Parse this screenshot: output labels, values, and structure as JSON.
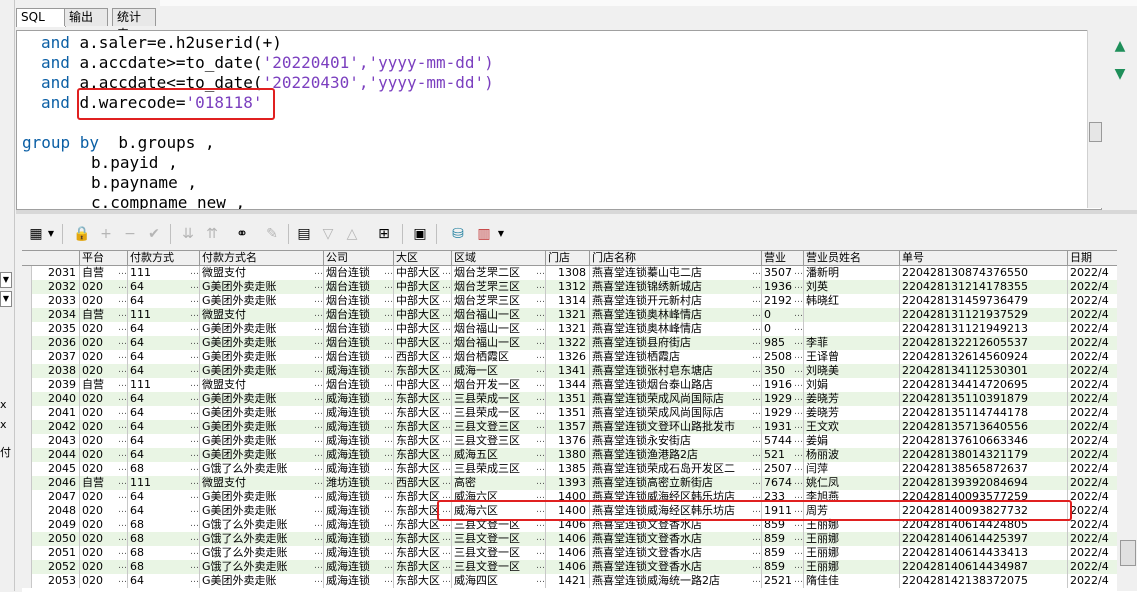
{
  "tabs": [
    "SQL",
    "输出",
    "统计表"
  ],
  "editor": {
    "lines": [
      {
        "kw": "and",
        "code": " a.saler=e.h2userid(+)",
        "str": ""
      },
      {
        "kw": "and",
        "code": " a.accdate>=to_date(",
        "str": "'20220401','yyyy-mm-dd')"
      },
      {
        "kw": "and",
        "code": " a.accdate<=to_date(",
        "str": "'20220430','yyyy-mm-dd')"
      },
      {
        "kw": "and",
        "code": " d.warecode=",
        "str": "'018118'"
      },
      {
        "kw": "",
        "code": "",
        "str": ""
      },
      {
        "kw": "group by",
        "code": "  b.groups ,",
        "str": ""
      },
      {
        "kw": "",
        "code": "b.payid ,",
        "str": ""
      },
      {
        "kw": "",
        "code": "b.payname ,",
        "str": ""
      },
      {
        "kw": "",
        "code": "c.compname_new ,",
        "str": ""
      }
    ]
  },
  "side_left": [
    "x",
    "x",
    "付"
  ],
  "toolbar_icons": [
    "grid-icon",
    "lock-icon",
    "add-icon",
    "delete-icon",
    "check-icon",
    "post-down-icon",
    "post-up-icon",
    "binoculars-icon",
    "eraser-icon",
    "export-icon",
    "sort-down-icon",
    "sort-up-icon",
    "tree-icon",
    "save-icon",
    "database-icon",
    "chart-icon"
  ],
  "columns": [
    "",
    "平台",
    "付款方式",
    "付款方式名",
    "公司",
    "大区",
    "区域",
    "门店",
    "门店名称",
    "营业",
    "营业员姓名",
    "单号",
    "日期"
  ],
  "rows": [
    [
      "2031",
      "自营",
      "111",
      "微盟支付",
      "烟台连锁",
      "中部大区",
      "烟台芝罘二区",
      "1308",
      "燕喜堂连锁蓁山屯二店",
      "3507",
      "潘新明",
      "220428130874376550",
      "2022/4"
    ],
    [
      "2032",
      "020",
      "64",
      "G美团外卖走账",
      "烟台连锁",
      "中部大区",
      "烟台芝罘三区",
      "1312",
      "燕喜堂连锁锦绣新城店",
      "1936",
      "刘英",
      "220428131214178355",
      "2022/4"
    ],
    [
      "2033",
      "020",
      "64",
      "G美团外卖走账",
      "烟台连锁",
      "中部大区",
      "烟台芝罘三区",
      "1314",
      "燕喜堂连锁开元新村店",
      "2192",
      "韩晓红",
      "220428131459736479",
      "2022/4"
    ],
    [
      "2034",
      "自营",
      "111",
      "微盟支付",
      "烟台连锁",
      "中部大区",
      "烟台福山一区",
      "1321",
      "燕喜堂连锁奥林峰情店",
      "0",
      "",
      "220428131121937529",
      "2022/4"
    ],
    [
      "2035",
      "020",
      "64",
      "G美团外卖走账",
      "烟台连锁",
      "中部大区",
      "烟台福山一区",
      "1321",
      "燕喜堂连锁奥林峰情店",
      "0",
      "",
      "220428131121949213",
      "2022/4"
    ],
    [
      "2036",
      "020",
      "64",
      "G美团外卖走账",
      "烟台连锁",
      "中部大区",
      "烟台福山一区",
      "1322",
      "燕喜堂连锁县府街店",
      "985",
      "李菲",
      "220428132212605537",
      "2022/4"
    ],
    [
      "2037",
      "020",
      "64",
      "G美团外卖走账",
      "烟台连锁",
      "西部大区",
      "烟台栖霞区",
      "1326",
      "燕喜堂连锁栖霞店",
      "2508",
      "王译曾",
      "220428132614560924",
      "2022/4"
    ],
    [
      "2038",
      "020",
      "64",
      "G美团外卖走账",
      "威海连锁",
      "东部大区",
      "威海一区",
      "1341",
      "燕喜堂连锁张村皂东塘店",
      "350",
      "刘晓美",
      "220428134112530301",
      "2022/4"
    ],
    [
      "2039",
      "自营",
      "111",
      "微盟支付",
      "烟台连锁",
      "中部大区",
      "烟台开发一区",
      "1344",
      "燕喜堂连锁烟台泰山路店",
      "1916",
      "刘娟",
      "220428134414720695",
      "2022/4"
    ],
    [
      "2040",
      "020",
      "64",
      "G美团外卖走账",
      "威海连锁",
      "东部大区",
      "三县荣成一区",
      "1351",
      "燕喜堂连锁荣成风尚国际店",
      "1929",
      "姜晓芳",
      "220428135110391879",
      "2022/4"
    ],
    [
      "2041",
      "020",
      "64",
      "G美团外卖走账",
      "威海连锁",
      "东部大区",
      "三县荣成一区",
      "1351",
      "燕喜堂连锁荣成风尚国际店",
      "1929",
      "姜晓芳",
      "220428135114744178",
      "2022/4"
    ],
    [
      "2042",
      "020",
      "64",
      "G美团外卖走账",
      "威海连锁",
      "东部大区",
      "三县文登三区",
      "1357",
      "燕喜堂连锁文登环山路批发市",
      "1931",
      "王文欢",
      "220428135713640556",
      "2022/4"
    ],
    [
      "2043",
      "020",
      "64",
      "G美团外卖走账",
      "威海连锁",
      "东部大区",
      "三县文登三区",
      "1376",
      "燕喜堂连锁永安街店",
      "5744",
      "姜娟",
      "220428137610663346",
      "2022/4"
    ],
    [
      "2044",
      "020",
      "64",
      "G美团外卖走账",
      "威海连锁",
      "东部大区",
      "威海五区",
      "1380",
      "燕喜堂连锁渔港路2店",
      "521",
      "杨丽波",
      "220428138014321179",
      "2022/4"
    ],
    [
      "2045",
      "020",
      "68",
      "G饿了么外卖走账",
      "威海连锁",
      "东部大区",
      "三县荣成三区",
      "1385",
      "燕喜堂连锁荣成石岛开发区二",
      "2507",
      "闫萍",
      "220428138565872637",
      "2022/4"
    ],
    [
      "2046",
      "自营",
      "111",
      "微盟支付",
      "潍坊连锁",
      "西部大区",
      "高密",
      "1393",
      "燕喜堂连锁高密立新街店",
      "7674",
      "姚仁凤",
      "220428139392084694",
      "2022/4"
    ],
    [
      "2047",
      "020",
      "64",
      "G美团外卖走账",
      "威海连锁",
      "东部大区",
      "威海六区",
      "1400",
      "燕喜堂连锁威海经区韩乐坊店",
      "233",
      "李旭燕",
      "220428140093577259",
      "2022/4"
    ],
    [
      "2048",
      "020",
      "64",
      "G美团外卖走账",
      "威海连锁",
      "东部大区",
      "威海六区",
      "1400",
      "燕喜堂连锁威海经区韩乐坊店",
      "1911",
      "周芳",
      "220428140093827732",
      "2022/4"
    ],
    [
      "2049",
      "020",
      "68",
      "G饿了么外卖走账",
      "威海连锁",
      "东部大区",
      "三县文登一区",
      "1406",
      "燕喜堂连锁文登香水店",
      "859",
      "王丽娜",
      "220428140614424805",
      "2022/4"
    ],
    [
      "2050",
      "020",
      "68",
      "G饿了么外卖走账",
      "威海连锁",
      "东部大区",
      "三县文登一区",
      "1406",
      "燕喜堂连锁文登香水店",
      "859",
      "王丽娜",
      "220428140614425397",
      "2022/4"
    ],
    [
      "2051",
      "020",
      "68",
      "G饿了么外卖走账",
      "威海连锁",
      "东部大区",
      "三县文登一区",
      "1406",
      "燕喜堂连锁文登香水店",
      "859",
      "王丽娜",
      "220428140614433413",
      "2022/4"
    ],
    [
      "2052",
      "020",
      "68",
      "G饿了么外卖走账",
      "威海连锁",
      "东部大区",
      "三县文登一区",
      "1406",
      "燕喜堂连锁文登香水店",
      "859",
      "王丽娜",
      "220428140614434987",
      "2022/4"
    ],
    [
      "2053",
      "020",
      "64",
      "G美团外卖走账",
      "威海连锁",
      "东部大区",
      "威海四区",
      "1421",
      "燕喜堂连锁威海统一路2店",
      "2521",
      "隋佳佳",
      "220428142138372075",
      "2022/4"
    ]
  ]
}
